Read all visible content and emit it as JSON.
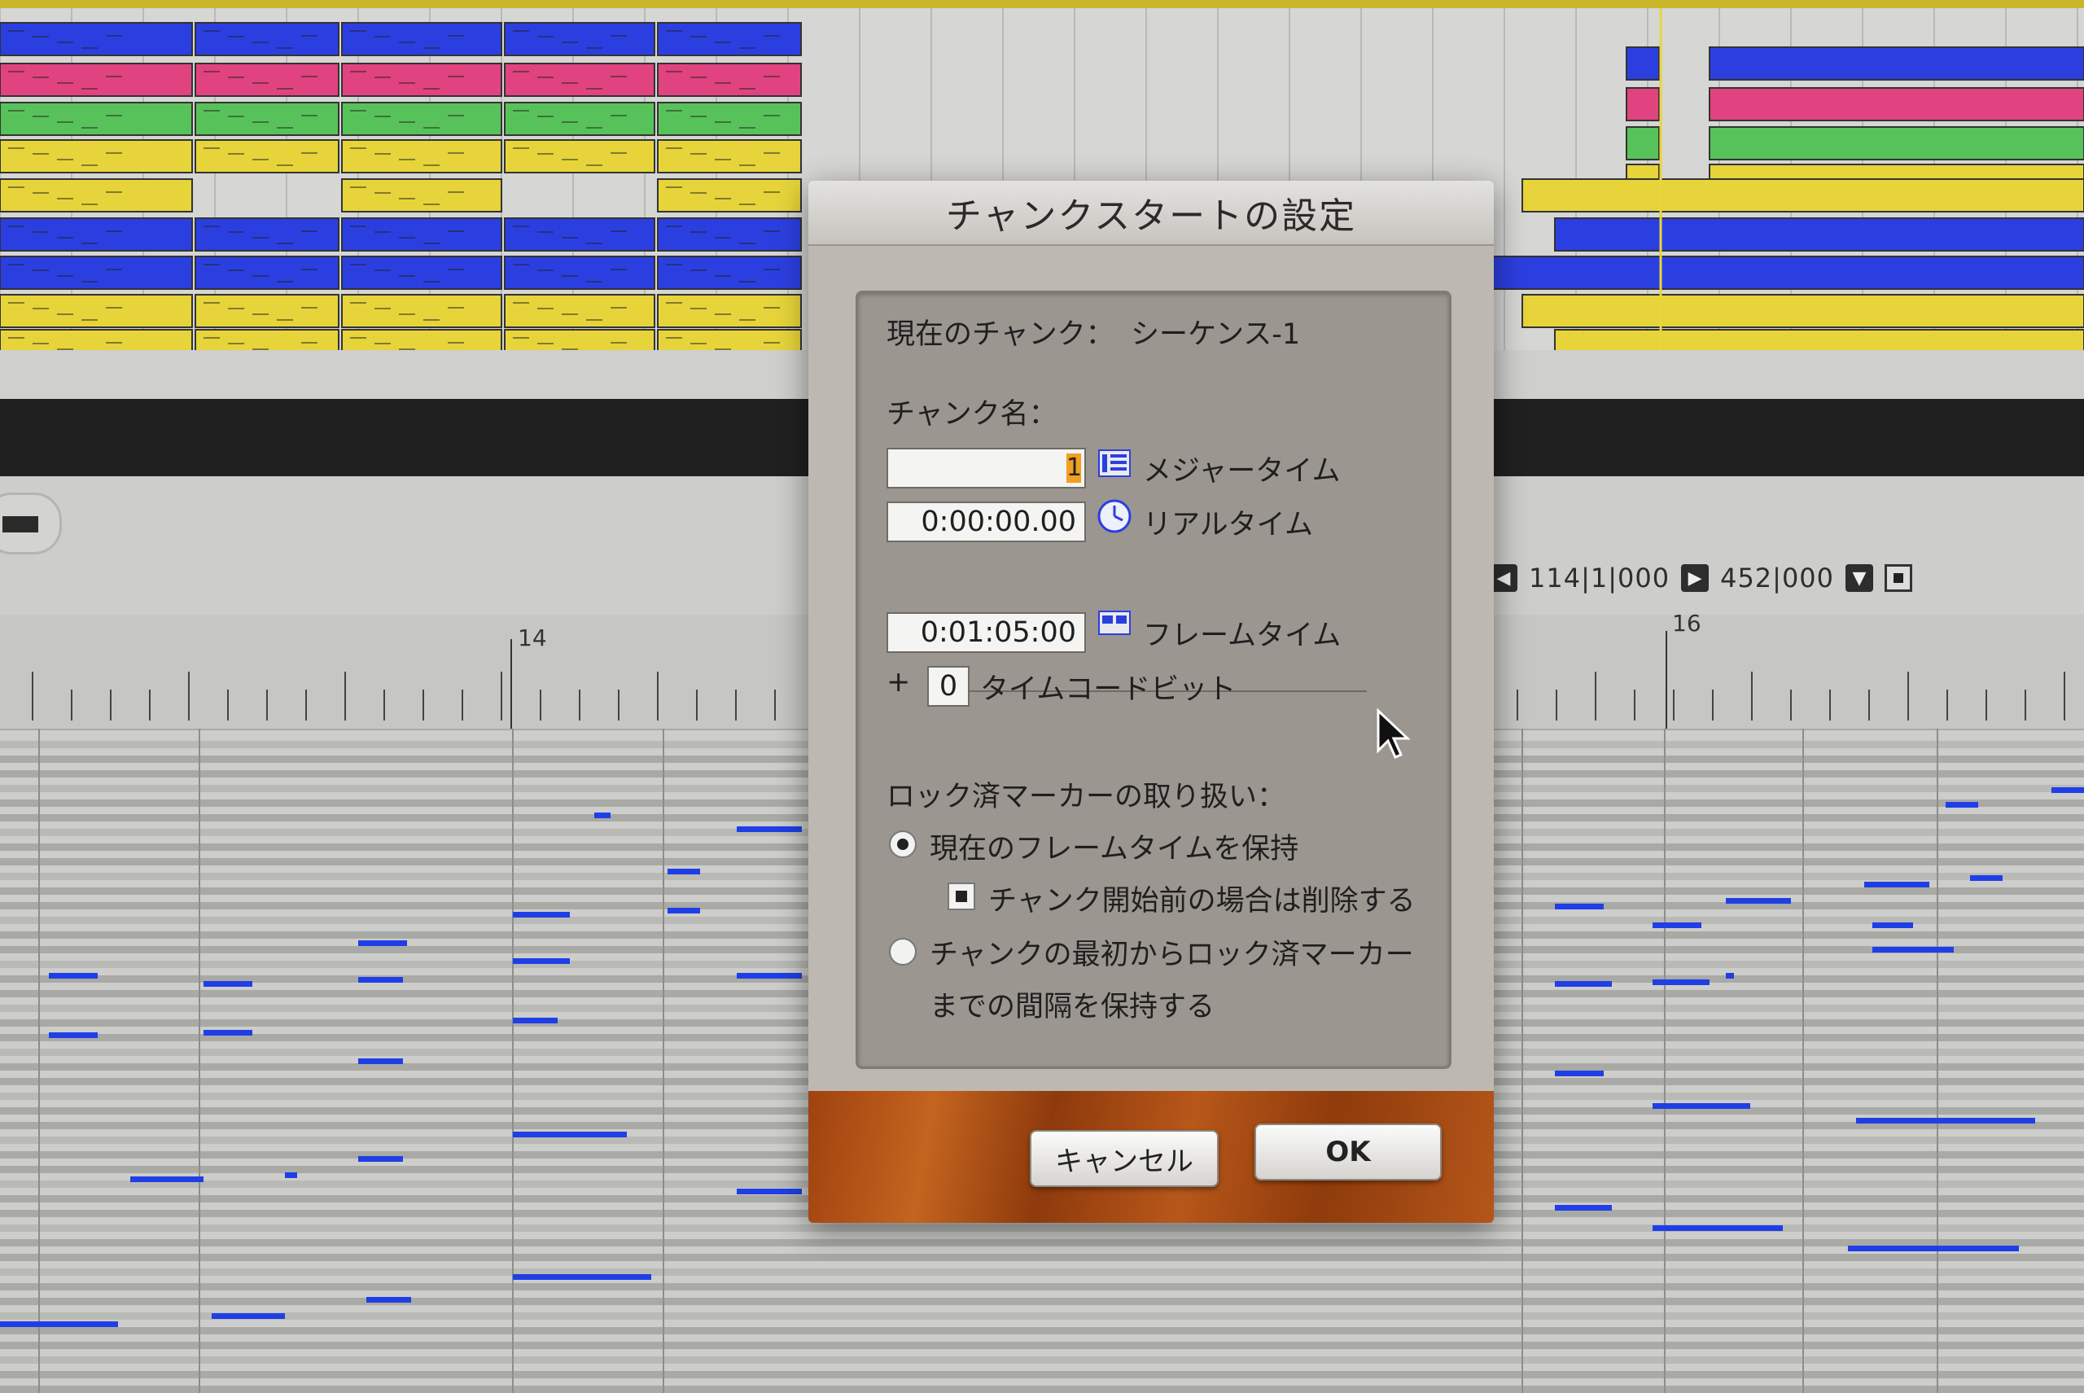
{
  "dialog": {
    "title": "チャンクスタートの設定",
    "current_chunk_label": "現在のチャンク：",
    "current_chunk_value": "シーケンス-1",
    "chunk_name_label": "チャンク名：",
    "major_time_value": "1",
    "major_time_label": "メジャータイム",
    "real_time_value": "0:00:00.00",
    "real_time_label": "リアルタイム",
    "frame_time_value": "0:01:05:00",
    "frame_time_label": "フレームタイム",
    "plus_sign": "+",
    "timecode_bits_value": "0",
    "timecode_bits_label": "タイムコードビット",
    "locked_markers_label": "ロック済マーカーの取り扱い：",
    "option_keep_frame_time": "現在のフレームタイムを保持",
    "option_delete_before_chunk": "チャンク開始前の場合は削除する",
    "option_keep_interval_line1": "チャンクの最初からロック済マーカー",
    "option_keep_interval_line2": "までの間隔を保持する",
    "cancel_label": "キャンセル",
    "ok_label": "OK"
  },
  "editor": {
    "counter_position": "114|1|000",
    "counter_length": "452|000",
    "ruler_label_14": "14",
    "ruler_label_16": "16"
  },
  "colors": {
    "track_blue": "#2b3fe0",
    "track_pink": "#e0437f",
    "track_green": "#58c25a",
    "track_yellow": "#e6d43a",
    "note_blue": "#1f3fe6",
    "footer_wood": "#a94a12"
  }
}
